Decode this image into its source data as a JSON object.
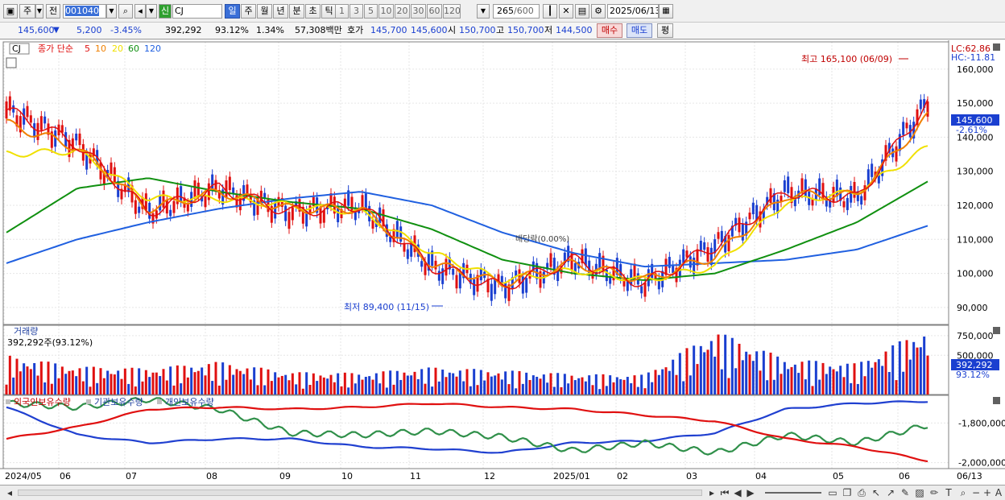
{
  "toolbar": {
    "period": "주",
    "mode": "전",
    "code": "001040",
    "name_badge": "신",
    "name": "CJ",
    "timeframes": [
      "일",
      "주",
      "월",
      "년",
      "분",
      "초",
      "틱"
    ],
    "intervals": [
      "1",
      "3",
      "5",
      "10",
      "20",
      "30",
      "60",
      "120"
    ],
    "count": "265",
    "count_total": "/600",
    "date": "2025/06/13"
  },
  "quote": {
    "price": "145,600",
    "change": "5,200",
    "change_pct": "-3.45%",
    "volume": "392,292",
    "volume_ratio": "93.12%",
    "turnover_pct": "1.34%",
    "amount": "57,308백만",
    "ask_label": "호가",
    "ask": "145,700",
    "bid": "145,600",
    "open_label": "시",
    "open": "150,700",
    "high_label": "고",
    "high": "150,700",
    "low_label": "저",
    "low": "144,500",
    "buy_label": "매수",
    "sell_label": "매도",
    "eval_label": "평"
  },
  "price_panel": {
    "symbol": "CJ",
    "legend_prefix": "종가 단순",
    "ma_periods": [
      "5",
      "10",
      "20",
      "60",
      "120"
    ],
    "lc": "LC:62.86",
    "hc": "HC:-11.81",
    "max_label": "최고 165,100 (06/09)",
    "min_label": "최저 89,400 (11/15)",
    "marker_label": "배당락(0.00%)",
    "current_tag": "145,600",
    "current_pct": "-2.61%",
    "y_ticks": [
      "160,000",
      "150,000",
      "140,000",
      "130,000",
      "120,000",
      "110,000",
      "100,000",
      "90,000"
    ]
  },
  "volume_panel": {
    "title": "거래량",
    "info": "392,292주(93.12%)",
    "y_ticks": [
      "750,000",
      "500,000"
    ],
    "current_tag": "392,292",
    "current_pct": "93.12%"
  },
  "holding_panel": {
    "legend": [
      "외국인보유수량",
      "기관보유수량",
      "개인보유수량"
    ],
    "y_ticks": [
      "-1,800,000",
      "-2,000,000"
    ]
  },
  "x_axis": [
    "2024/05",
    "06",
    "07",
    "08",
    "09",
    "10",
    "11",
    "12",
    "2025/01",
    "02",
    "03",
    "04",
    "05",
    "06"
  ],
  "x_right_label": "06/13",
  "colors": {
    "up": "#e01010",
    "down": "#1a3fd0",
    "ma5": "#e01010",
    "ma10": "#f08000",
    "ma20": "#f0e000",
    "ma60": "#109010",
    "ma120": "#2060e0",
    "foreign": "#2040d0",
    "institution": "#30904a",
    "individual": "#e01010"
  },
  "chart_data": [
    {
      "type": "line",
      "title": "CJ",
      "x": [
        "2024/05",
        "06",
        "07",
        "08",
        "09",
        "10",
        "11",
        "12",
        "2025/01",
        "02",
        "03",
        "04",
        "05",
        "06"
      ],
      "series": [
        {
          "name": "5",
          "values": [
            148000,
            138000,
            118000,
            125000,
            118000,
            120000,
            102000,
            96000,
            104000,
            97000,
            108000,
            124000,
            122000,
            150000
          ]
        },
        {
          "name": "10",
          "values": [
            144000,
            137000,
            119000,
            124000,
            119000,
            119000,
            103000,
            97000,
            103000,
            98000,
            105000,
            123000,
            123000,
            146000
          ]
        },
        {
          "name": "20",
          "values": [
            135000,
            136000,
            122000,
            122000,
            120000,
            118000,
            106000,
            98000,
            101000,
            98000,
            102000,
            121000,
            124000,
            137000
          ]
        },
        {
          "name": "60",
          "values": [
            112000,
            125000,
            128000,
            124000,
            121000,
            119000,
            113000,
            104000,
            100000,
            98000,
            100000,
            107000,
            115000,
            127000
          ]
        },
        {
          "name": "120",
          "values": [
            103000,
            110000,
            115000,
            119000,
            122000,
            124000,
            120000,
            112000,
            106000,
            102000,
            103000,
            104000,
            107000,
            114000
          ]
        }
      ],
      "ylim": [
        85000,
        168000
      ],
      "annotations": [
        "최고 165,100 (06/09)",
        "최저 89,400 (11/15)",
        "배당락(0.00%)"
      ]
    },
    {
      "type": "bar",
      "title": "거래량",
      "x": [
        "2024/05",
        "06",
        "07",
        "08",
        "09",
        "10",
        "11",
        "12",
        "2025/01",
        "02",
        "03",
        "04",
        "05",
        "06"
      ],
      "values": [
        420000,
        300000,
        280000,
        350000,
        240000,
        230000,
        290000,
        260000,
        220000,
        210000,
        680000,
        380000,
        330000,
        720000
      ],
      "ylim": [
        0,
        800000
      ]
    },
    {
      "type": "line",
      "title": "",
      "x": [
        "2024/05",
        "06",
        "07",
        "08",
        "09",
        "10",
        "11",
        "12",
        "2025/01",
        "02",
        "03",
        "04",
        "05",
        "06"
      ],
      "series": [
        {
          "name": "외국인보유수량",
          "values": [
            -1720000,
            -1860000,
            -1900000,
            -1880000,
            -1880000,
            -1920000,
            -1930000,
            -1950000,
            -1900000,
            -1890000,
            -1850000,
            -1730000,
            -1700000,
            -1690000
          ]
        },
        {
          "name": "기관보유수량",
          "values": [
            -1700000,
            -1720000,
            -1680000,
            -1730000,
            -1850000,
            -1860000,
            -1840000,
            -1870000,
            -1940000,
            -1900000,
            -1950000,
            -1860000,
            -1900000,
            -1810000
          ]
        },
        {
          "name": "개인보유수량",
          "values": [
            -1880000,
            -1820000,
            -1730000,
            -1720000,
            -1730000,
            -1720000,
            -1700000,
            -1720000,
            -1730000,
            -1760000,
            -1790000,
            -1880000,
            -1920000,
            -1990000
          ]
        }
      ],
      "ylim": [
        -2030000,
        -1660000
      ]
    }
  ]
}
